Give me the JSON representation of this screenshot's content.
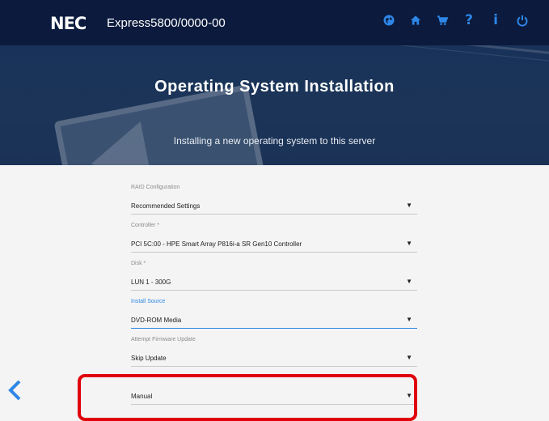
{
  "header": {
    "logo": "NEC",
    "model": "Express5800/0000-00",
    "icons": [
      "globe-icon",
      "home-icon",
      "cart-icon",
      "help-icon",
      "info-icon",
      "power-icon"
    ],
    "help_glyph": "?",
    "info_glyph": "i"
  },
  "hero": {
    "title": "Operating System Installation",
    "subtitle": "Installing a new operating system to this server"
  },
  "form": {
    "fields": [
      {
        "label": "RAID Configuration",
        "value": "Recommended Settings",
        "active": false
      },
      {
        "label": "Controller *",
        "value": "PCI 5C:00 - HPE Smart Array P816i-a SR Gen10 Controller",
        "active": false
      },
      {
        "label": "Disk *",
        "value": "LUN 1 - 300G",
        "active": false
      },
      {
        "label": "Install Source",
        "value": "DVD-ROM Media",
        "active": true
      },
      {
        "label": "Attempt Firmware Update",
        "value": "Skip Update",
        "active": false
      },
      {
        "label": "",
        "value": "Manual",
        "active": false
      }
    ],
    "caret": "▼"
  },
  "colors": {
    "header_bg": "#0b1a3d",
    "accent": "#2e86e6",
    "highlight": "#e0000c"
  }
}
